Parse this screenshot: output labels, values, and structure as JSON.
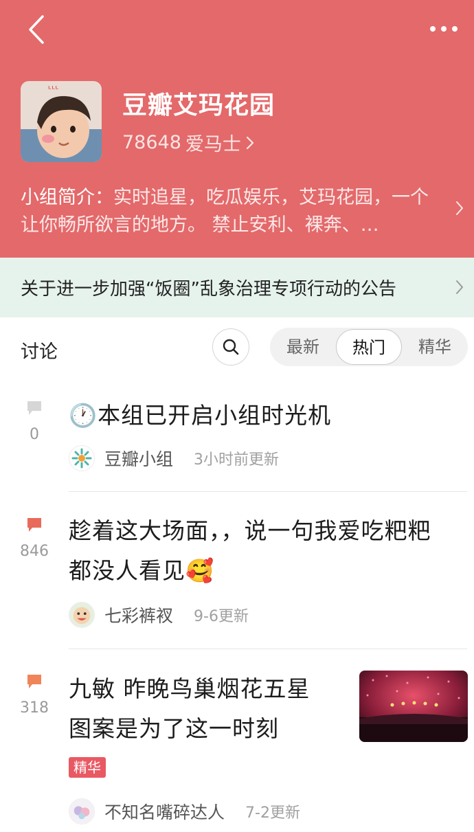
{
  "header": {
    "group_name": "豆瓣艾玛花园",
    "member_count": "78648",
    "member_title": "爱马士",
    "intro_label": "小组简介：",
    "intro_text": "实时追星，吃瓜娱乐，艾玛花园，一个让你畅所欲言的地方。 禁止安利、裸奔、…",
    "avatar_scribble": "ᶫᶫᶫ"
  },
  "notice": {
    "text": "关于进一步加强“饭圈”乱象治理专项行动的公告"
  },
  "tabs": {
    "label": "讨论",
    "segments": [
      "最新",
      "热门",
      "精华"
    ],
    "active": "热门"
  },
  "posts": [
    {
      "count": "0",
      "title": "🕐本组已开启小组时光机",
      "author": "豆瓣小组",
      "time": "3小时前更新",
      "icon_color": "#d6d6d6"
    },
    {
      "count": "846",
      "title_line1": "趁着这大场面，，说一句我爱吃粑粑",
      "title_line2": "都没人看见🥰",
      "author": "七彩裤衩",
      "time": "9-6更新",
      "icon_color": "#e86a5a"
    },
    {
      "count": "318",
      "title_line1": "九敏 昨晚鸟巢烟花五星",
      "title_line2": "图案是为了这一时刻",
      "badge": "精华",
      "author": "不知名嘴碎达人",
      "time": "7-2更新",
      "icon_color": "#f0855a"
    }
  ],
  "colors": {
    "header_bg": "#e4696a",
    "notice_bg": "#e6f3ec",
    "badge_bg": "#e95963"
  }
}
